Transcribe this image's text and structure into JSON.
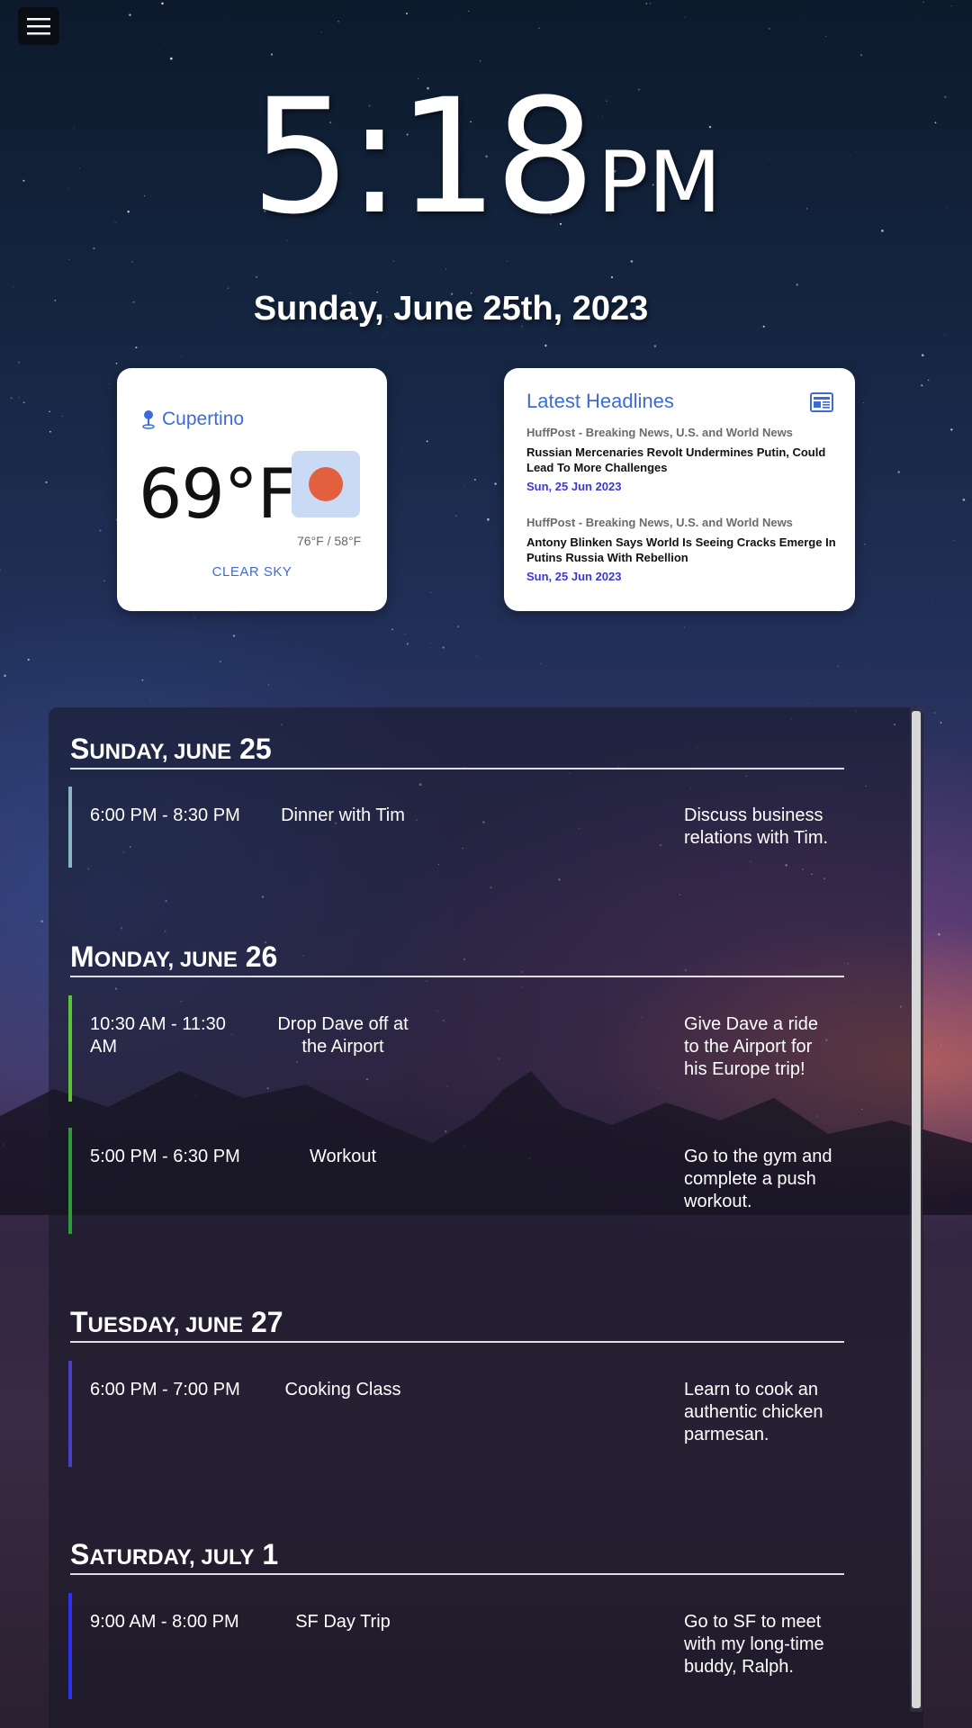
{
  "clock": {
    "time": "5:18",
    "ampm": "PM"
  },
  "date": "Sunday, June 25th, 2023",
  "weather": {
    "location": "Cupertino",
    "temperature": "69°F",
    "hi_lo": "76°F / 58°F",
    "condition": "CLEAR SKY",
    "icon": "sun-icon",
    "icon_color": "#e3603e"
  },
  "news": {
    "title": "Latest Headlines",
    "icon": "newspaper-icon",
    "items": [
      {
        "source": "HuffPost - Breaking News, U.S. and World News",
        "headline": "Russian Mercenaries Revolt Undermines Putin, Could Lead To More Challenges",
        "date": "Sun, 25 Jun 2023"
      },
      {
        "source": "HuffPost - Breaking News, U.S. and World News",
        "headline": "Antony Blinken Says World Is Seeing Cracks Emerge In Putins Russia With Rebellion",
        "date": "Sun, 25 Jun 2023"
      }
    ]
  },
  "agenda": {
    "days": [
      {
        "weekday": "Sunday",
        "month": "June",
        "day": "25",
        "events": [
          {
            "time": "6:00 PM - 8:30 PM",
            "name": "Dinner with Tim",
            "description": "Discuss business relations with Tim.",
            "color": "#8ab6c4"
          }
        ]
      },
      {
        "weekday": "Monday",
        "month": "June",
        "day": "26",
        "events": [
          {
            "time": "10:30 AM - 11:30 AM",
            "name": "Drop Dave off at the Airport",
            "description": "Give Dave a ride to the Airport for his Europe trip!",
            "color": "#5cc23a"
          },
          {
            "time": "5:00 PM - 6:30 PM",
            "name": "Workout",
            "description": "Go to the gym and complete a push workout.",
            "color": "#2e9a3a"
          }
        ]
      },
      {
        "weekday": "Tuesday",
        "month": "June",
        "day": "27",
        "events": [
          {
            "time": "6:00 PM - 7:00 PM",
            "name": "Cooking Class",
            "description": "Learn to cook an authentic chicken parmesan.",
            "color": "#4a3fc2"
          }
        ]
      },
      {
        "weekday": "Saturday",
        "month": "July",
        "day": "1",
        "events": [
          {
            "time": "9:00 AM - 8:00 PM",
            "name": "SF Day Trip",
            "description": "Go to SF to meet with my long-time buddy, Ralph.",
            "color": "#2f2ff0"
          }
        ]
      }
    ]
  }
}
